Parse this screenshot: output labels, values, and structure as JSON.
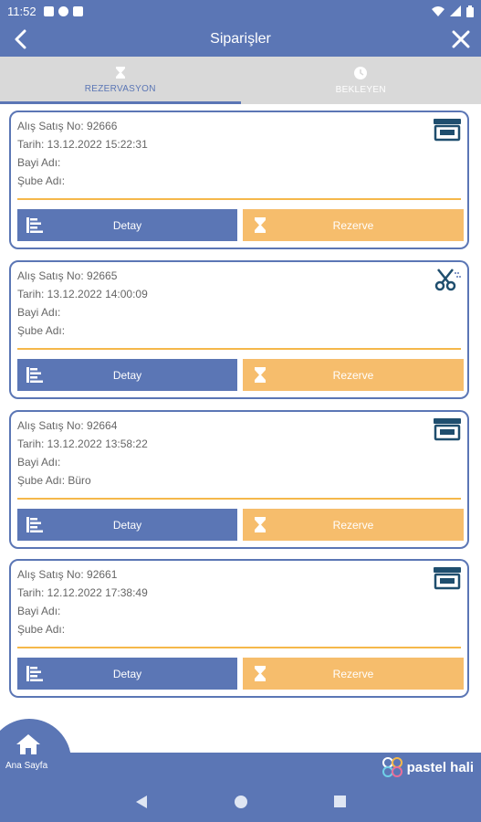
{
  "status": {
    "time": "11:52",
    "icons": [
      "a-icon",
      "f-icon",
      "sim-icon"
    ],
    "right_icons": [
      "wifi-icon",
      "signal-icon",
      "battery-icon"
    ]
  },
  "appbar": {
    "title": "Siparişler",
    "back_icon": "back-arrow-icon",
    "close_icon": "close-icon"
  },
  "tabs": [
    {
      "label": "REZERVASYON",
      "icon": "hourglass-icon",
      "active": true
    },
    {
      "label": "BEKLEYEN",
      "icon": "clock-icon",
      "active": false
    }
  ],
  "orders": [
    {
      "no_line": "Alış Satış No: 92666",
      "date_line": "Tarih: 13.12.2022 15:22:31",
      "dealer_line": "Bayi Adı:",
      "branch_line": "Şube Adı:",
      "type_icon": "cash-register-icon",
      "detail_label": "Detay",
      "reserve_label": "Rezerve"
    },
    {
      "no_line": "Alış Satış No: 92665",
      "date_line": "Tarih: 13.12.2022 14:00:09",
      "dealer_line": "Bayi Adı:",
      "branch_line": "Şube Adı:",
      "type_icon": "scissors-icon",
      "detail_label": "Detay",
      "reserve_label": "Rezerve"
    },
    {
      "no_line": "Alış Satış No: 92664",
      "date_line": "Tarih: 13.12.2022 13:58:22",
      "dealer_line": "Bayi Adı:",
      "branch_line": "Şube Adı: Büro",
      "type_icon": "cash-register-icon",
      "detail_label": "Detay",
      "reserve_label": "Rezerve"
    },
    {
      "no_line": "Alış Satış No: 92661",
      "date_line": "Tarih: 12.12.2022 17:38:49",
      "dealer_line": "Bayi Adı:",
      "branch_line": "Şube Adı:",
      "type_icon": "cash-register-icon",
      "detail_label": "Detay",
      "reserve_label": "Rezerve"
    }
  ],
  "bottom": {
    "home_label": "Ana Sayfa",
    "brand": "pastel hali"
  },
  "colors": {
    "primary": "#5b76b5",
    "accent": "#f6bd6c",
    "divider": "#f5b84a",
    "tab_bg": "#d9d9d9"
  }
}
